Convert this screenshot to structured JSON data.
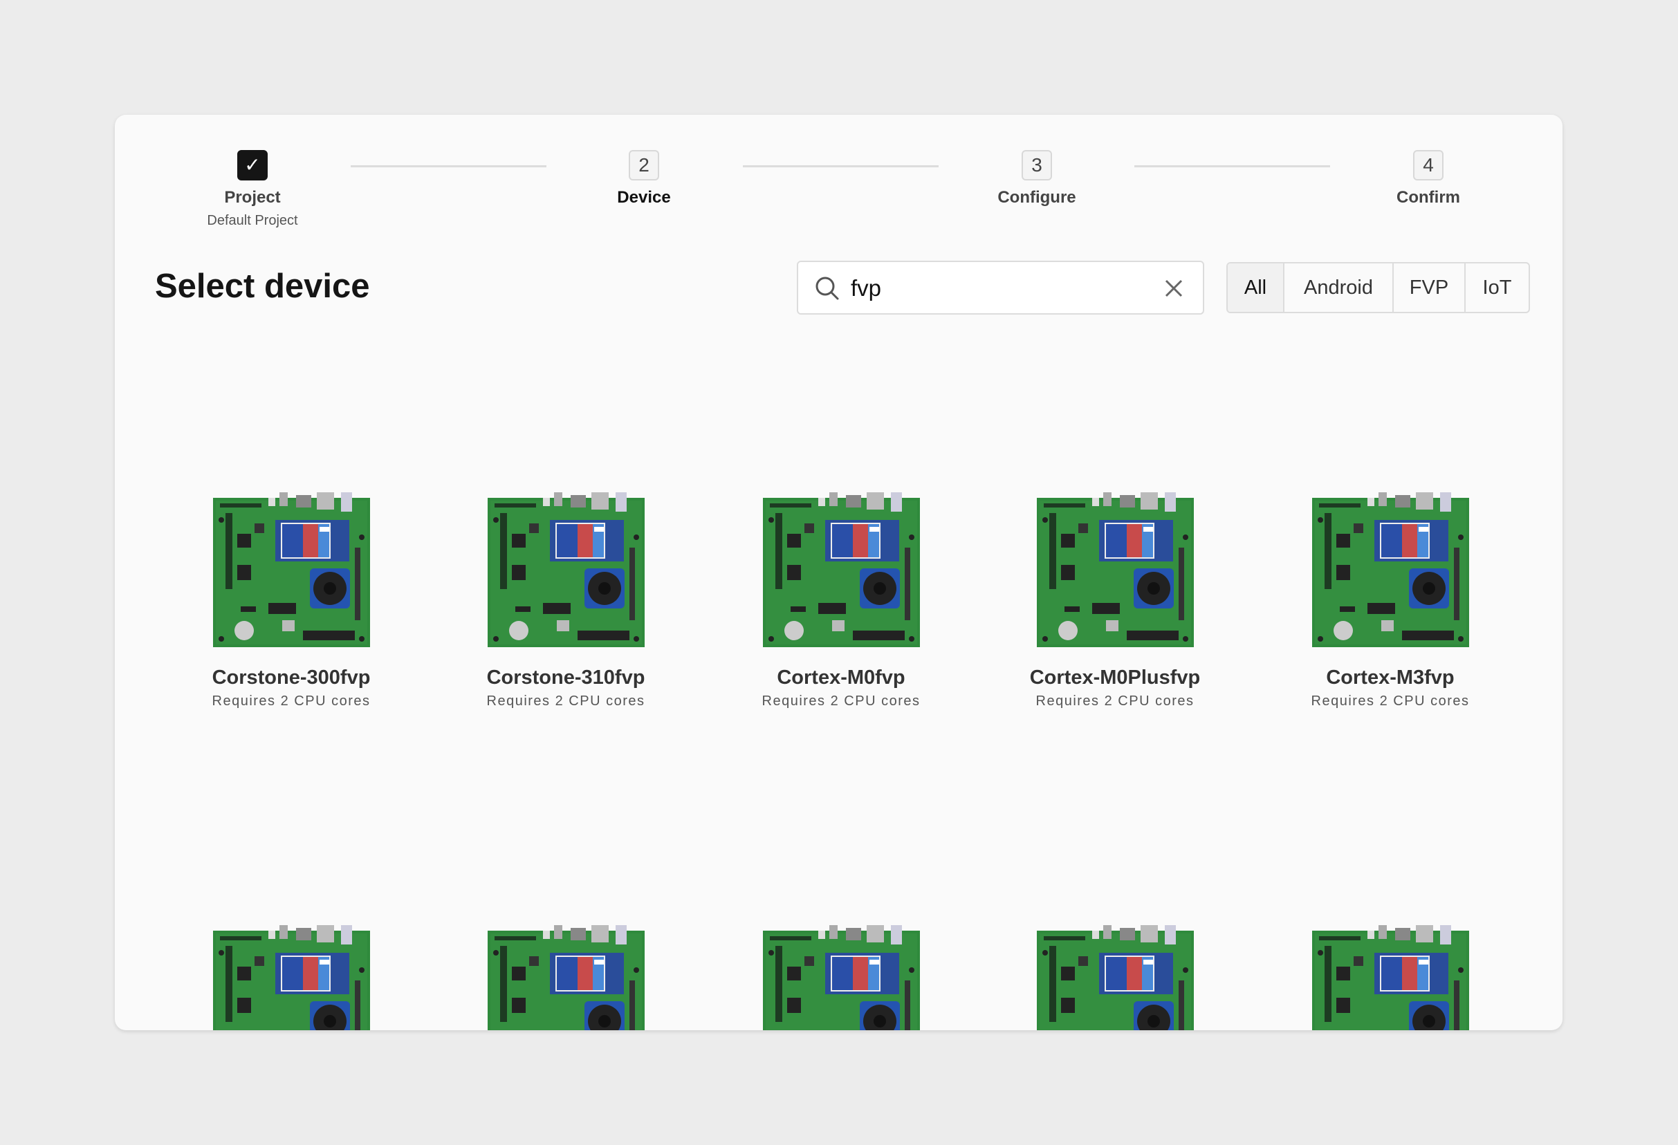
{
  "stepper": [
    {
      "number": "1",
      "label": "Project",
      "sub": "Default Project",
      "state": "done",
      "icon": "check-icon"
    },
    {
      "number": "2",
      "label": "Device",
      "sub": "",
      "state": "active"
    },
    {
      "number": "3",
      "label": "Configure",
      "sub": "",
      "state": "pending"
    },
    {
      "number": "4",
      "label": "Confirm",
      "sub": "",
      "state": "pending"
    }
  ],
  "page": {
    "title": "Select device"
  },
  "search": {
    "value": "fvp",
    "icon": "search-icon",
    "clear_icon": "close-icon"
  },
  "filters": {
    "options": [
      "All",
      "Android",
      "FVP",
      "IoT"
    ],
    "selected": "All"
  },
  "devices": [
    {
      "name": "Corstone-300fvp",
      "requirement": "Requires 2 CPU cores"
    },
    {
      "name": "Corstone-310fvp",
      "requirement": "Requires 2 CPU cores"
    },
    {
      "name": "Cortex-M0fvp",
      "requirement": "Requires 2 CPU cores"
    },
    {
      "name": "Cortex-M0Plusfvp",
      "requirement": "Requires 2 CPU cores"
    },
    {
      "name": "Cortex-M3fvp",
      "requirement": "Requires 2 CPU cores"
    }
  ],
  "colors": {
    "board": "#2f8a3c",
    "checkbox": "#151515",
    "background": "#ececec"
  }
}
